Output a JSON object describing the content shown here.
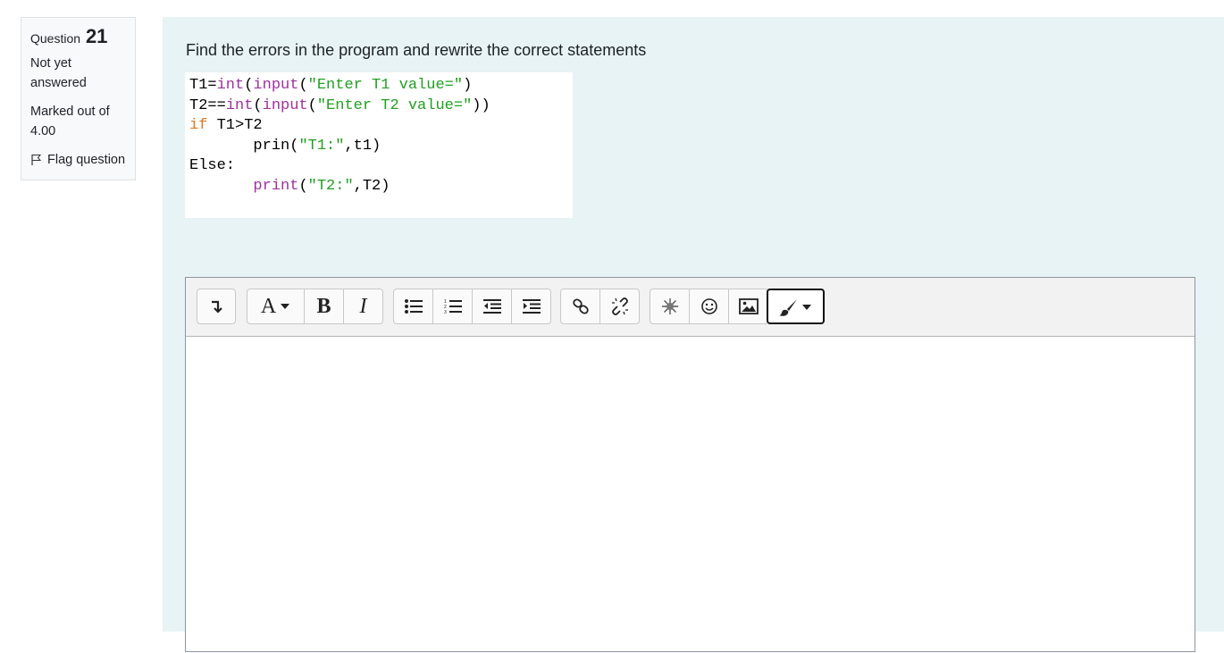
{
  "question_info": {
    "label": "Question",
    "number": "21",
    "state": "Not yet answered",
    "grade": "Marked out of 4.00",
    "flag_label": "Flag question"
  },
  "question": {
    "text": "Find the errors in the program and rewrite the correct statements"
  },
  "code": {
    "line1": {
      "a": "T1=",
      "b": "int",
      "c": "(",
      "d": "input",
      "e": "(",
      "f": "\"Enter T1 value=\"",
      "g": ")"
    },
    "line2": {
      "a": "T2==",
      "b": "int",
      "c": "(",
      "d": "input",
      "e": "(",
      "f": "\"Enter T2 value=\"",
      "g": "))"
    },
    "line3": {
      "a": "if",
      "b": " T1>T2"
    },
    "line4": {
      "a": "prin",
      "b": "(",
      "c": "\"T1:\"",
      "d": ",t1)"
    },
    "line5": {
      "a": "Else:"
    },
    "line6": {
      "a": "print",
      "b": "(",
      "c": "\"T2:\"",
      "d": ",T2)"
    }
  },
  "toolbar": {
    "font_a": "A",
    "bold": "B",
    "italic": "I",
    "icons": [
      "collapse-icon",
      "font-color-icon",
      "bold-icon",
      "italic-icon",
      "unordered-list-icon",
      "ordered-list-icon",
      "outdent-icon",
      "indent-icon",
      "link-icon",
      "unlink-icon",
      "equation-icon",
      "emoji-icon",
      "image-icon",
      "brush-icon"
    ]
  },
  "colors": {
    "function": "#a030a0",
    "keyword": "#e07820",
    "string": "#20a020",
    "content_bg": "#e7f3f5"
  }
}
